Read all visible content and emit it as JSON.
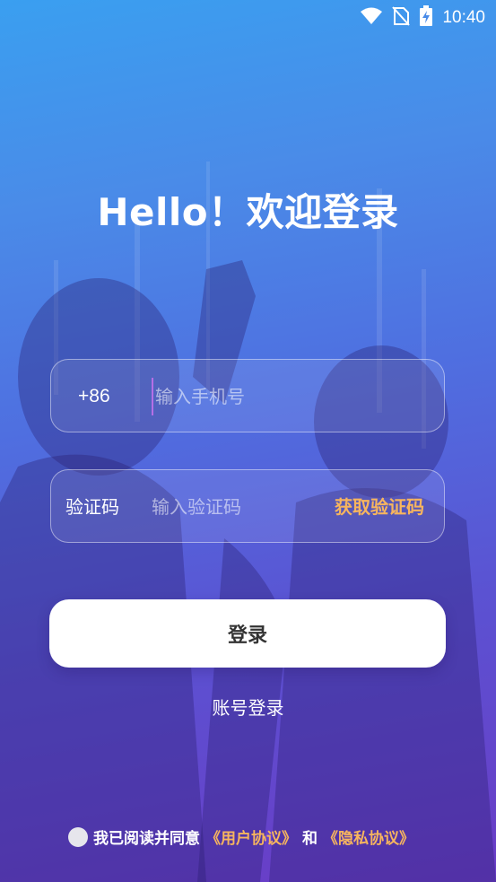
{
  "status_bar": {
    "time": "10:40",
    "icons": [
      "wifi-icon",
      "no-sim-icon",
      "battery-charging-icon"
    ]
  },
  "title": "Hello！欢迎登录",
  "phone_field": {
    "prefix": "+86",
    "placeholder": "输入手机号",
    "value": ""
  },
  "code_field": {
    "label": "验证码",
    "placeholder": "输入验证码",
    "value": "",
    "get_code_label": "获取验证码"
  },
  "login_button": "登录",
  "account_login": "账号登录",
  "agreement": {
    "prefix": "我已阅读并同意",
    "user_agreement": "《用户协议》",
    "and": "和",
    "privacy_policy": "《隐私协议》",
    "checked": false
  },
  "colors": {
    "accent": "#f7b55e",
    "background_top": "#3a9ff0",
    "background_bottom": "#6a3cc6"
  }
}
